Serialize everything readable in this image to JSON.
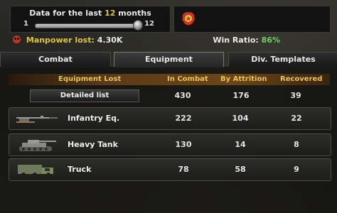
{
  "time_range": {
    "label_prefix": "Data for the last",
    "months": "12",
    "label_suffix": "months",
    "slider_min": "1",
    "slider_max": "12",
    "slider_value": 12
  },
  "stats": {
    "manpower_label": "Manpower lost:",
    "manpower_value": "4.30K",
    "win_ratio_label": "Win Ratio:",
    "win_ratio_value": "86%"
  },
  "tabs": [
    {
      "label": "Combat",
      "active": false
    },
    {
      "label": "Equipment",
      "active": true
    },
    {
      "label": "Div. Templates",
      "active": false
    }
  ],
  "table": {
    "headers": {
      "equipment": "Equipment Lost",
      "in_combat": "In Combat",
      "by_attrition": "By Attrition",
      "recovered": "Recovered"
    },
    "detailed_list_label": "Detailed list",
    "totals": {
      "in_combat": "430",
      "by_attrition": "176",
      "recovered": "39"
    },
    "rows": [
      {
        "name": "Infantry Eq.",
        "icon": "rifle-icon",
        "in_combat": "222",
        "by_attrition": "104",
        "recovered": "22"
      },
      {
        "name": "Heavy Tank",
        "icon": "tank-icon",
        "in_combat": "130",
        "by_attrition": "14",
        "recovered": "8"
      },
      {
        "name": "Truck",
        "icon": "truck-icon",
        "in_combat": "78",
        "by_attrition": "58",
        "recovered": "9"
      }
    ]
  },
  "colors": {
    "accent_yellow": "#e0c246",
    "win_green": "#6fd06a",
    "header_orange": "#e9c350",
    "skull_red": "#b8372c"
  }
}
